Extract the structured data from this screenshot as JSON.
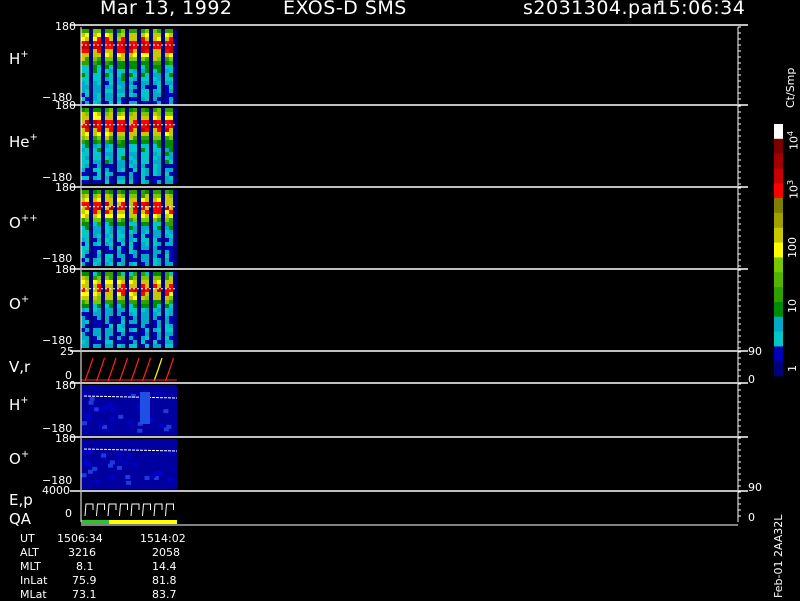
{
  "header": {
    "date": "Mar 13, 1992",
    "instrument": "EXOS-D SMS",
    "file": "s2031304.par",
    "time": "15:06:34"
  },
  "panels": [
    {
      "label": "H",
      "sup": "+",
      "ymax": "180",
      "ymin": "−180"
    },
    {
      "label": "He",
      "sup": "+",
      "ymax": "180",
      "ymin": "−180"
    },
    {
      "label": "O",
      "sup": "++",
      "ymax": "180",
      "ymin": "−180"
    },
    {
      "label": "O",
      "sup": "+",
      "ymax": "180",
      "ymin": "−180"
    },
    {
      "label": "V,r",
      "sup": "",
      "ymax": "25",
      "ymin": "0",
      "rmax": "90",
      "rmin": "0"
    },
    {
      "label": "H",
      "sup": "+",
      "ymax": "180",
      "ymin": "−180"
    },
    {
      "label": "O",
      "sup": "+",
      "ymax": "180",
      "ymin": "−180"
    },
    {
      "label": "E,p",
      "label2": "QA",
      "ymax": "4000",
      "ymin": "0",
      "rmax": "90",
      "rmin": "0"
    }
  ],
  "colorbar": {
    "unit": "Ct/Smp",
    "ticks": [
      {
        "base": "10",
        "exp": "4"
      },
      {
        "base": "10",
        "exp": "3"
      },
      {
        "base": "100",
        "exp": ""
      },
      {
        "base": "10",
        "exp": ""
      },
      {
        "base": "1",
        "exp": ""
      }
    ],
    "colors": [
      "#ffffff",
      "#7a0000",
      "#a00000",
      "#c80000",
      "#ff0000",
      "#808000",
      "#a0a000",
      "#c8c800",
      "#ffff00",
      "#78c800",
      "#50b400",
      "#30a000",
      "#008c00",
      "#00aac8",
      "#00c8c8",
      "#0000b4",
      "#000078"
    ]
  },
  "footer": {
    "rows": [
      {
        "name": "UT",
        "v1": "1506:34",
        "v2": "1514:02"
      },
      {
        "name": "ALT",
        "v1": "3216",
        "v2": "2058"
      },
      {
        "name": "MLT",
        "v1": "8.1",
        "v2": "14.4"
      },
      {
        "name": "InLat",
        "v1": "75.9",
        "v2": "81.8"
      },
      {
        "name": "MLat",
        "v1": "73.1",
        "v2": "83.7"
      }
    ],
    "stamp": "Feb-01 2AA32L"
  },
  "chart_data": {
    "type": "heatmap",
    "title": "Mar 13, 1992   EXOS-D SMS",
    "time_range": [
      "1506:34",
      "1514:02"
    ],
    "panels": [
      "H+",
      "He+",
      "O++",
      "O+",
      "V,r",
      "H+",
      "O+",
      "E,p / QA"
    ],
    "colorbar_range": [
      1,
      10000
    ],
    "colorbar_scale": "log"
  }
}
